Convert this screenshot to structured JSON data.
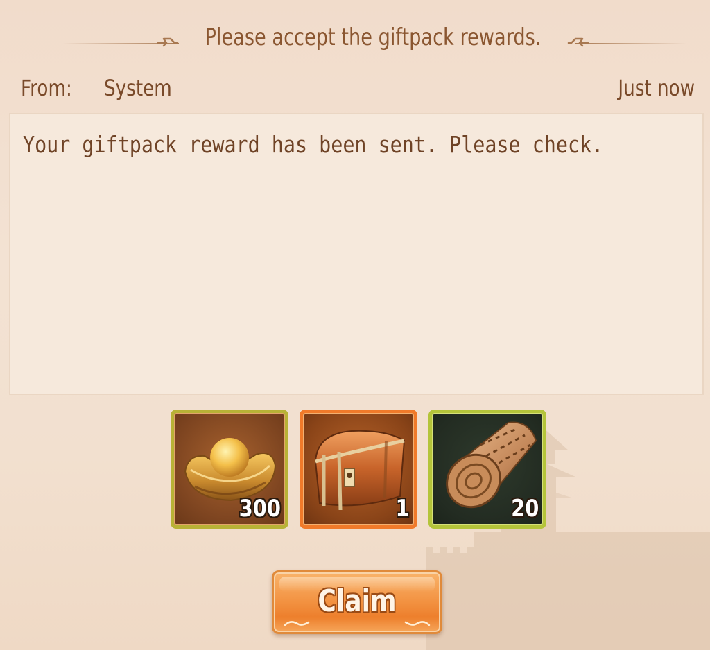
{
  "header": {
    "title": "Please accept the giftpack rewards."
  },
  "mail": {
    "from_label": "From:",
    "from_value": "System",
    "time": "Just now",
    "body": "Your giftpack reward has been sent. Please check."
  },
  "rewards": [
    {
      "icon": "gold-ingot-icon",
      "count": "300",
      "frame_color": "#b8b236"
    },
    {
      "icon": "treasure-chest-icon",
      "count": "1",
      "frame_color": "#f07a2a"
    },
    {
      "icon": "wood-log-icon",
      "count": "20",
      "frame_color": "#b4c43a"
    }
  ],
  "actions": {
    "claim_label": "Claim"
  },
  "colors": {
    "background": "#f2e0cf",
    "text": "#7a4a2a",
    "accent": "#ed7f2c"
  }
}
